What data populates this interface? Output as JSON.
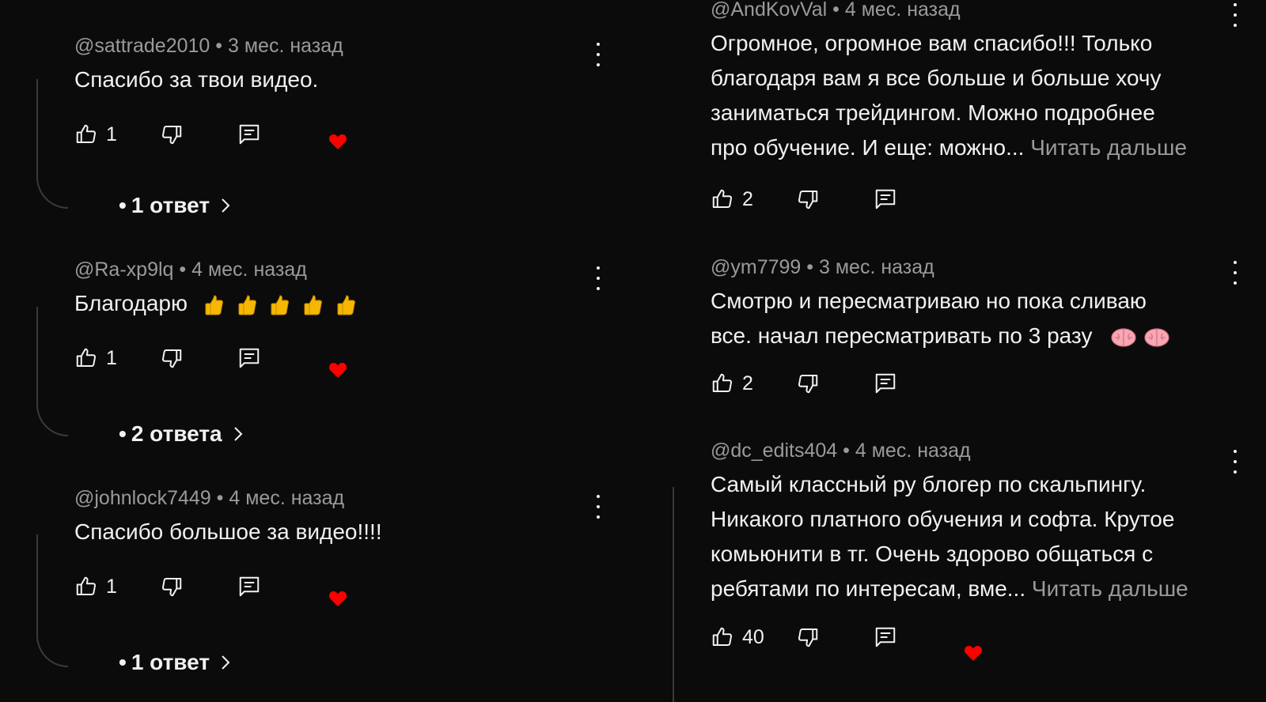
{
  "left_comments": [
    {
      "author": "@sattrade2010",
      "age": "3 мес. назад",
      "text": "Спасибо за твои видео.",
      "likes": "1",
      "replies_label": "1 ответ",
      "hearted": true
    },
    {
      "author": "@Ra-xp9lq",
      "age": "4 мес. назад",
      "text": "Благодарю",
      "emoji": [
        "thumbs-up-icon",
        "thumbs-up-icon",
        "thumbs-up-icon",
        "thumbs-up-icon",
        "thumbs-up-icon"
      ],
      "likes": "1",
      "replies_label": "2 ответа",
      "hearted": true
    },
    {
      "author": "@johnlock7449",
      "age": "4 мес. назад",
      "text": "Спасибо большое за видео!!!!",
      "likes": "1",
      "replies_label": "1 ответ",
      "hearted": true
    }
  ],
  "right_comments": [
    {
      "author": "@AndKovVal",
      "age": "4 мес. назад",
      "lines": [
        "Огромное, огромное вам спасибо!!! Только",
        "благодаря вам я все больше и больше хочу",
        "заниматься трейдингом. Можно подробнее",
        "про обучение. И еще: можно..."
      ],
      "read_more": "Читать дальше",
      "likes": "2",
      "hearted": false
    },
    {
      "author": "@ym7799",
      "age": "3 мес. назад",
      "lines": [
        "Смотрю и пересматриваю но пока сливаю",
        "все. начал пересматривать по 3 разу"
      ],
      "emoji": [
        "brain-icon",
        "brain-icon"
      ],
      "likes": "2",
      "hearted": false
    },
    {
      "author": "@dc_edits404",
      "age": "4 мес. назад",
      "lines": [
        "Самый классный ру блогер по скальпингу.",
        "Никакого платного обучения и софта. Крутое",
        "комьюнити в тг. Очень здорово общаться с",
        "ребятами по интересам, вме..."
      ],
      "read_more": "Читать дальше",
      "likes": "40",
      "hearted": true
    }
  ],
  "separator": "•",
  "colors": {
    "background": "#0b0b0b",
    "text": "#f1f1f1",
    "secondary": "#9a9a9a",
    "heart": "#ff0000",
    "thread": "#3a3a3a"
  }
}
